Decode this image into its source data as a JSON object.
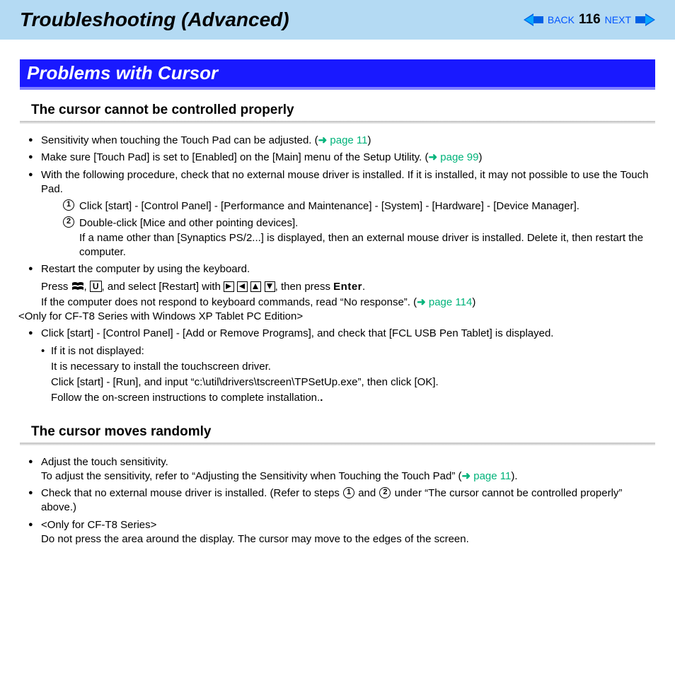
{
  "header": {
    "title": "Troubleshooting (Advanced)",
    "back": "BACK",
    "page": "116",
    "next": "NEXT"
  },
  "section": {
    "title": "Problems with Cursor"
  },
  "sub1": {
    "heading": "The cursor cannot be controlled properly",
    "b1_a": "Sensitivity when touching the Touch Pad can be adjusted. (",
    "b1_link": "page 11",
    "b1_b": ")",
    "b2_a": "Make sure [Touch Pad] is set to [Enabled] on the [Main] menu of the Setup Utility. (",
    "b2_link": "page 99",
    "b2_b": ")",
    "b3": "With the following procedure, check that no external mouse driver is installed. If it is installed, it may not possible to use the Touch Pad.",
    "step1": "Click [start] - [Control Panel] - [Performance and Maintenance] - [System] - [Hardware] - [Device Manager].",
    "step2_l1": "Double-click [Mice and other pointing devices].",
    "step2_l2": "If a name other than [Synaptics PS/2...] is displayed, then an external mouse driver is installed. Delete it, then restart the computer.",
    "b4": "Restart the computer by using the keyboard.",
    "press_a": "Press ",
    "press_b": ", ",
    "press_c": ", and select [Restart] with ",
    "press_d": ",  then press ",
    "enter": "Enter",
    "press_e": ".",
    "noresp_a": "If the computer does not respond to keyboard commands, read “No response”. (",
    "noresp_link": "page 114",
    "noresp_b": ")",
    "only": "<Only for CF-T8 Series with Windows XP Tablet PC Edition>",
    "b5": "Click [start] - [Control Panel] - [Add or Remove Programs], and check that [FCL USB Pen Tablet] is displayed.",
    "sb1": "If it is not displayed:",
    "pl1": "It is necessary to install the touchscreen driver.",
    "pl2": "Click [start] - [Run], and input “c:\\util\\drivers\\tscreen\\TPSetUp.exe”, then click [OK].",
    "pl3": "Follow the on-screen instructions to complete installation."
  },
  "sub2": {
    "heading": "The cursor moves randomly",
    "b1_l1": "Adjust the touch sensitivity.",
    "b1_l2a": "To adjust the sensitivity, refer to “Adjusting the Sensitivity when Touching the Touch Pad” (",
    "b1_link": "page 11",
    "b1_l2b": ").",
    "b2_a": "Check that no external mouse driver is installed. (Refer to steps ",
    "b2_mid": " and ",
    "b2_b": " under “The cursor cannot be controlled properly” above.)",
    "b3_l1": "<Only for CF-T8 Series>",
    "b3_l2": "Do not press the area around the display. The cursor may move to the edges of the screen."
  }
}
